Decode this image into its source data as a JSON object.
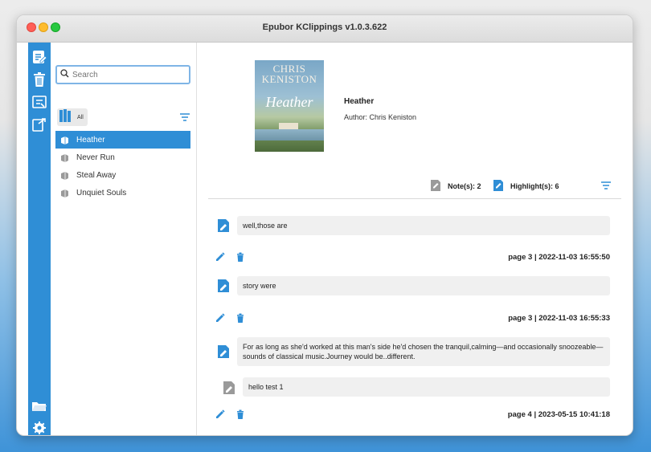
{
  "window": {
    "title": "Epubor KClippings v1.0.3.622"
  },
  "rail": {
    "top_icons": [
      "clippings-icon",
      "trash-icon",
      "export-icon",
      "share-icon"
    ],
    "bottom_icons": [
      "folder-icon",
      "settings-icon"
    ]
  },
  "search": {
    "placeholder": "Search",
    "value": ""
  },
  "filter": {
    "all_label": "All"
  },
  "books": [
    {
      "title": "Heather",
      "selected": true
    },
    {
      "title": "Never Run",
      "selected": false
    },
    {
      "title": "Steal Away",
      "selected": false
    },
    {
      "title": "Unquiet Souls",
      "selected": false
    }
  ],
  "detail": {
    "cover": {
      "author_line1": "CHRIS",
      "author_line2": "KENISTON",
      "title": "Heather"
    },
    "title": "Heather",
    "author": "Author: Chris Keniston",
    "notes_label": "Note(s): 2",
    "highlights_label": "Highlight(s): 6"
  },
  "entries": [
    {
      "type": "highlight",
      "text": "well,those are"
    },
    {
      "type": "meta",
      "text": "page 3 | 2022-11-03 16:55:50"
    },
    {
      "type": "highlight",
      "text": "story were"
    },
    {
      "type": "meta",
      "text": "page 3 | 2022-11-03 16:55:33"
    },
    {
      "type": "highlight",
      "text": "For as long as she'd worked at this man's side he'd chosen the tranquil,calming—and occasionally snoozeable—sounds of classical music.Journey would be..different."
    },
    {
      "type": "note",
      "text": "hello test 1"
    },
    {
      "type": "meta",
      "text": "page 4 | 2023-05-15 10:41:18"
    }
  ],
  "colors": {
    "accent": "#2f8ed6",
    "bubble": "#f0f0f0",
    "note_gray": "#9a9a9a"
  }
}
